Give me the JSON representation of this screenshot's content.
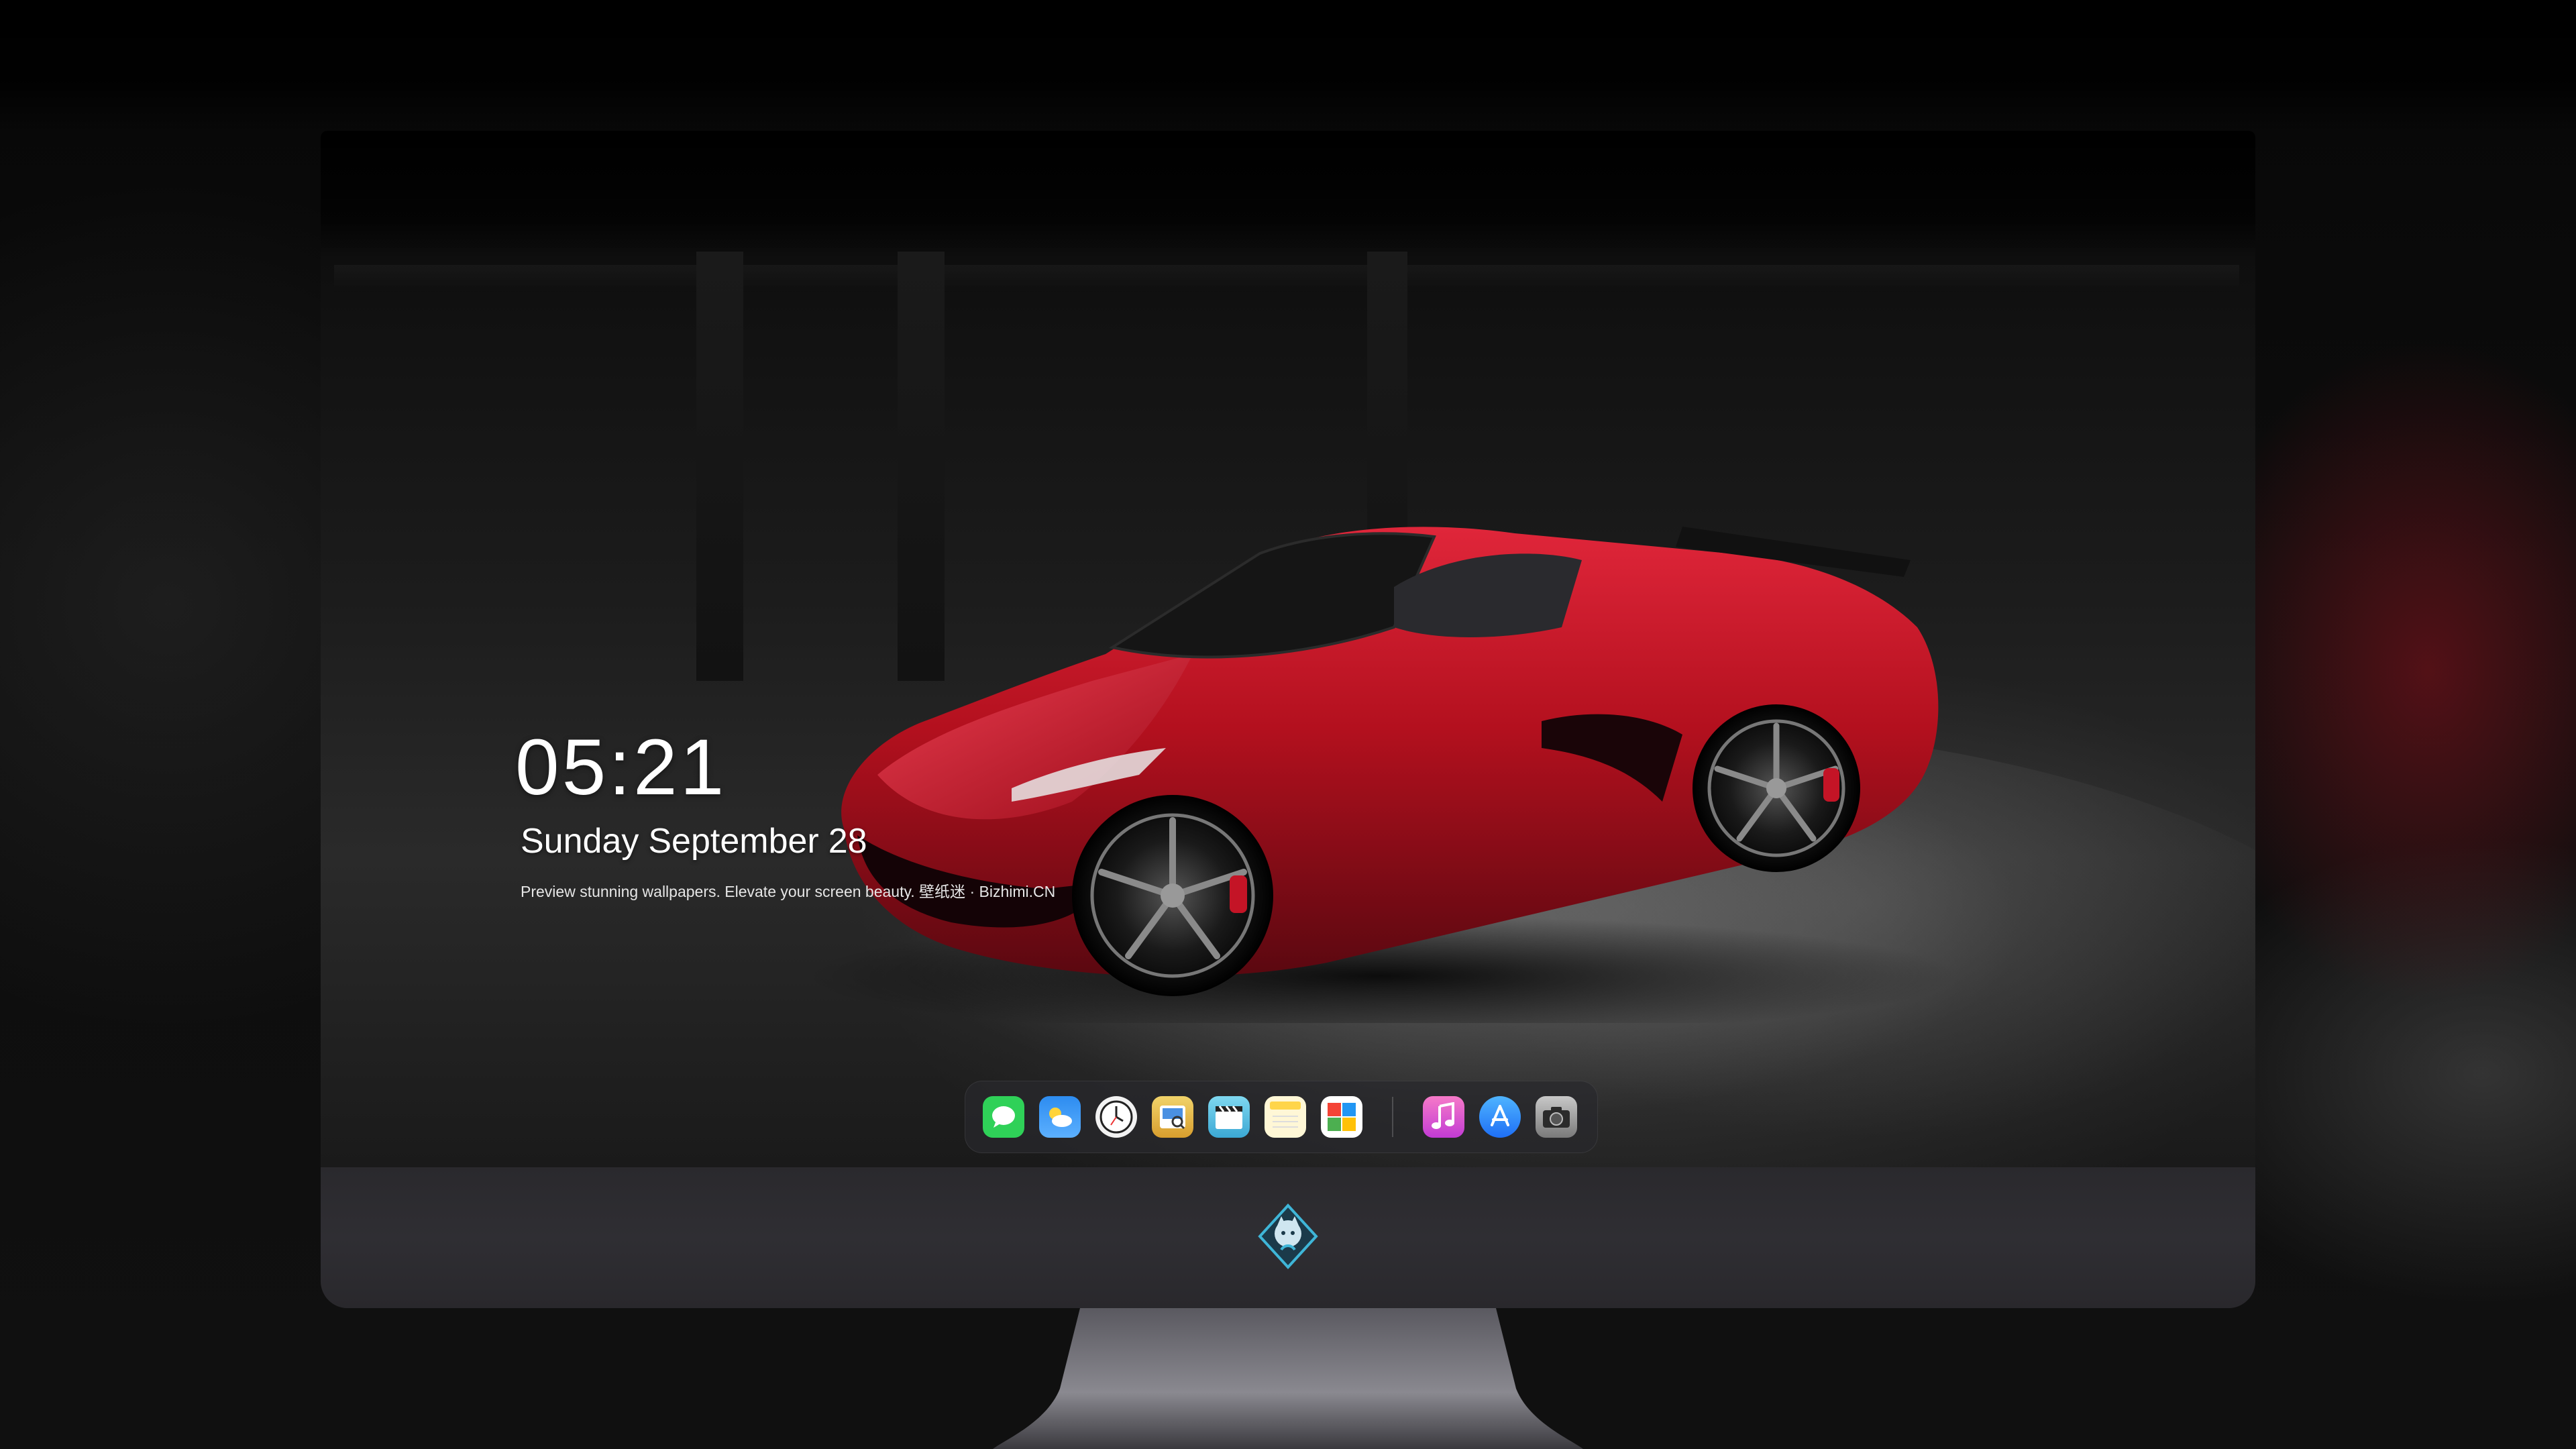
{
  "lockscreen": {
    "time": "05:21",
    "date_weekday": "Sunday",
    "date_month": "September",
    "date_day": "28",
    "tagline": "Preview stunning wallpapers. Elevate your screen beauty. 壁纸迷 · Bizhimi.CN"
  },
  "dock": {
    "apps": [
      {
        "name": "messages-icon",
        "color": "#2fd158"
      },
      {
        "name": "weather-icon",
        "color": "#2d8cf0"
      },
      {
        "name": "clock-icon",
        "color": "#f2f2f2"
      },
      {
        "name": "preview-icon",
        "color": "#e9c24a"
      },
      {
        "name": "clips-icon",
        "color": "#5bc8e8"
      },
      {
        "name": "notes-icon",
        "color": "#ffd54a"
      },
      {
        "name": "photos-icon",
        "color": "#4caf50"
      },
      {
        "name": "music-icon",
        "color": "#e84ba6"
      },
      {
        "name": "app-store-icon",
        "color": "#1e8bf5"
      },
      {
        "name": "camera-icon",
        "color": "#9a9a9a"
      }
    ]
  },
  "colors": {
    "car_red": "#b3101e",
    "bezel": "#2d2c31"
  }
}
